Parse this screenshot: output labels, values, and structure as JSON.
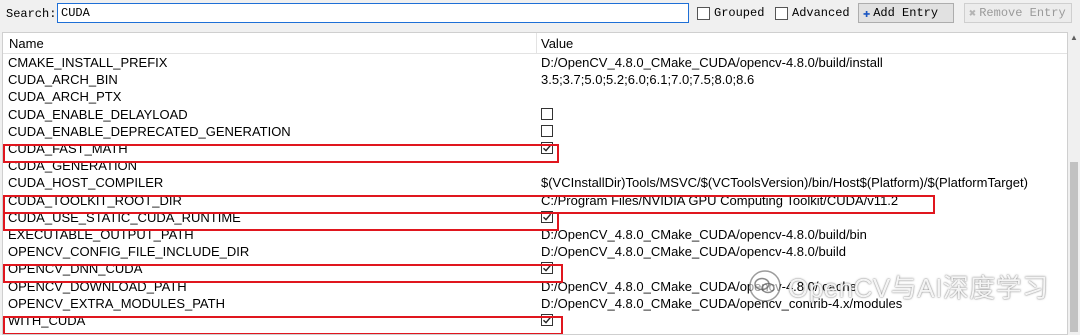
{
  "toolbar": {
    "search_label": "Search:",
    "search_value": "CUDA",
    "grouped_label": "Grouped",
    "grouped_checked": false,
    "advanced_label": "Advanced",
    "advanced_checked": false,
    "add_entry_label": "Add Entry",
    "remove_entry_label": "Remove Entry",
    "add_icon": "plus-icon",
    "remove_icon": "cross-icon"
  },
  "table": {
    "header_name": "Name",
    "header_value": "Value",
    "rows": [
      {
        "name": "CMAKE_INSTALL_PREFIX",
        "type": "text",
        "value": "D:/OpenCV_4.8.0_CMake_CUDA/opencv-4.8.0/build/install"
      },
      {
        "name": "CUDA_ARCH_BIN",
        "type": "text",
        "value": "3.5;3.7;5.0;5.2;6.0;6.1;7.0;7.5;8.0;8.6"
      },
      {
        "name": "CUDA_ARCH_PTX",
        "type": "text",
        "value": ""
      },
      {
        "name": "CUDA_ENABLE_DELAYLOAD",
        "type": "bool",
        "checked": false
      },
      {
        "name": "CUDA_ENABLE_DEPRECATED_GENERATION",
        "type": "bool",
        "checked": false
      },
      {
        "name": "CUDA_FAST_MATH",
        "type": "bool",
        "checked": true
      },
      {
        "name": "CUDA_GENERATION",
        "type": "text",
        "value": ""
      },
      {
        "name": "CUDA_HOST_COMPILER",
        "type": "text",
        "value": "$(VCInstallDir)Tools/MSVC/$(VCToolsVersion)/bin/Host$(Platform)/$(PlatformTarget)"
      },
      {
        "name": "CUDA_TOOLKIT_ROOT_DIR",
        "type": "text",
        "value": "C:/Program Files/NVIDIA GPU Computing Toolkit/CUDA/v11.2"
      },
      {
        "name": "CUDA_USE_STATIC_CUDA_RUNTIME",
        "type": "bool",
        "checked": true
      },
      {
        "name": "EXECUTABLE_OUTPUT_PATH",
        "type": "text",
        "value": "D:/OpenCV_4.8.0_CMake_CUDA/opencv-4.8.0/build/bin"
      },
      {
        "name": "OPENCV_CONFIG_FILE_INCLUDE_DIR",
        "type": "text",
        "value": "D:/OpenCV_4.8.0_CMake_CUDA/opencv-4.8.0/build"
      },
      {
        "name": "OPENCV_DNN_CUDA",
        "type": "bool",
        "checked": true
      },
      {
        "name": "OPENCV_DOWNLOAD_PATH",
        "type": "text",
        "value": "D:/OpenCV_4.8.0_CMake_CUDA/opencv-4.8.0/.cache"
      },
      {
        "name": "OPENCV_EXTRA_MODULES_PATH",
        "type": "text",
        "value": "D:/OpenCV_4.8.0_CMake_CUDA/opencv_contrib-4.x/modules"
      },
      {
        "name": "WITH_CUDA",
        "type": "bool",
        "checked": true
      }
    ]
  },
  "watermark": {
    "text": "OpenCV与AI深度学习",
    "icon": "wechat-logo-icon"
  },
  "colors": {
    "highlight": "#e0161e",
    "search_border": "#1e6fd6"
  }
}
